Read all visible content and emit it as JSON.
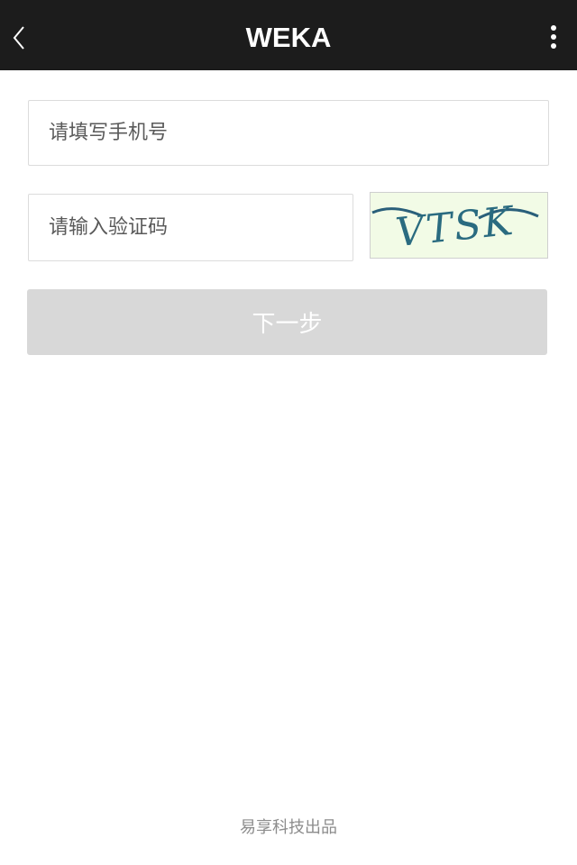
{
  "header": {
    "title": "WEKA",
    "back_icon": "chevron-left-icon",
    "menu_icon": "more-vertical-icon",
    "background": "#1c1c1c"
  },
  "form": {
    "phone_placeholder": "请填写手机号",
    "code_placeholder": "请输入验证码",
    "captcha_text": "VTSK",
    "next_label": "下一步",
    "next_button_color": "#d8d8d8"
  },
  "footer": {
    "text": "易享科技出品"
  }
}
